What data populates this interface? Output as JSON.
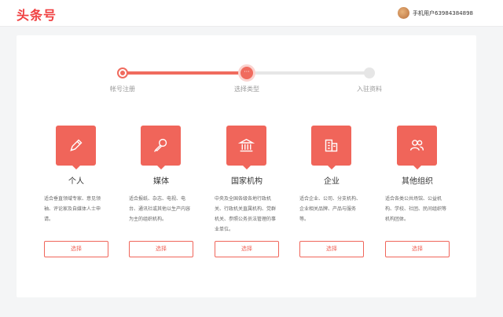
{
  "header": {
    "logo": "头条号",
    "username": "手机用户63984384898"
  },
  "stepper": {
    "steps": [
      {
        "label": "帐号注册",
        "state": "done"
      },
      {
        "label": "选择类型",
        "state": "current",
        "marker": "···"
      },
      {
        "label": "入驻资料",
        "state": "todo"
      }
    ]
  },
  "types": [
    {
      "title": "个人",
      "icon": "pen-icon",
      "desc": "适合垂直领域专家、意见领袖、评论家及自媒体人士申请。",
      "button": "选择"
    },
    {
      "title": "媒体",
      "icon": "microphone-icon",
      "desc": "适合报纸、杂志、电视、电台、通讯社或其他以生产内容为主的组织机构。",
      "button": "选择"
    },
    {
      "title": "国家机构",
      "icon": "government-building-icon",
      "desc": "中央及全国各级各地行政机关、行政机关直属机构、党群机关、参照公务员法管理的事业单位。",
      "button": "选择"
    },
    {
      "title": "企业",
      "icon": "office-building-icon",
      "desc": "适合企业、公司、分支机构、企业相关品牌、产品与服务等。",
      "button": "选择"
    },
    {
      "title": "其他组织",
      "icon": "people-icon",
      "desc": "适合各类公共场馆、公益机构、学校、社团、民间组织等机构团体。",
      "button": "选择"
    }
  ],
  "colors": {
    "brand": "#f04142",
    "accent": "#f0655a",
    "track_todo": "#e6e6e6"
  }
}
